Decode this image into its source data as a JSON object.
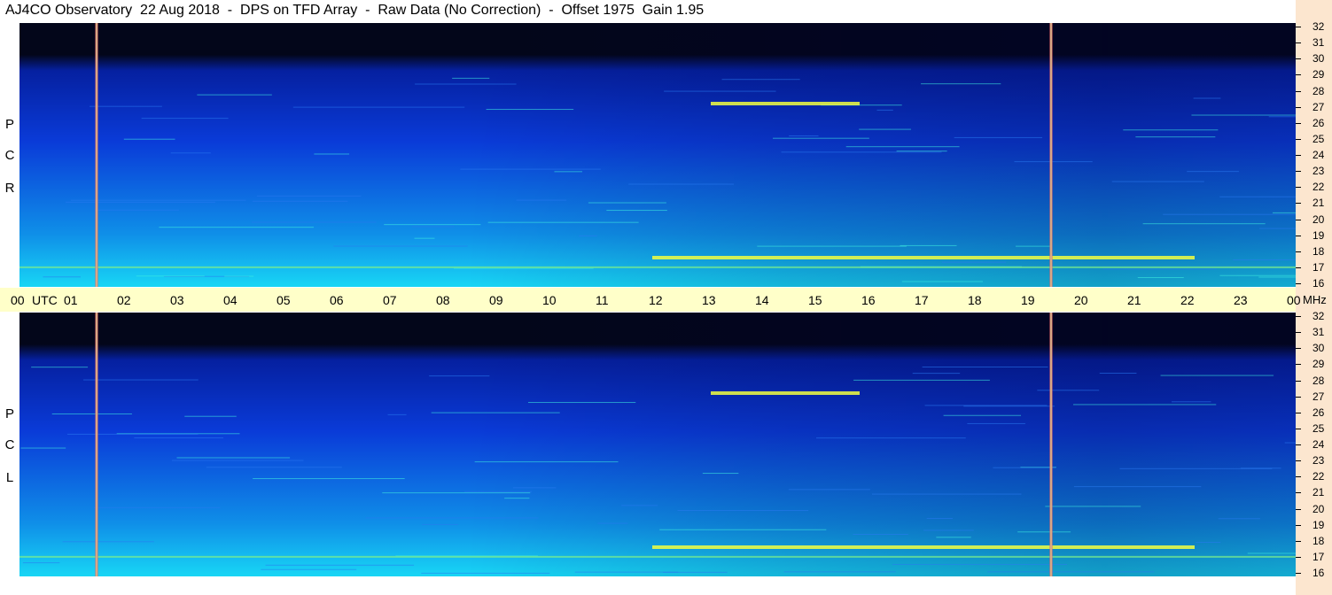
{
  "title": "AJ4CO Observatory  22 Aug 2018  -  DPS on TFD Array  -  Raw Data (No Correction)  -  Offset 1975  Gain 1.95",
  "panels": [
    {
      "id": "rcp",
      "label_letters": [
        "R",
        "C",
        "P"
      ]
    },
    {
      "id": "lcp",
      "label_letters": [
        "L",
        "C",
        "P"
      ]
    }
  ],
  "time_axis": {
    "start_label": "00",
    "unit_label": "UTC",
    "hour_labels": [
      "01",
      "02",
      "03",
      "04",
      "05",
      "06",
      "07",
      "08",
      "09",
      "10",
      "11",
      "12",
      "13",
      "14",
      "15",
      "16",
      "17",
      "18",
      "19",
      "20",
      "21",
      "22",
      "23"
    ],
    "end_label": "00",
    "end_unit": "MHz"
  },
  "chart_data": [
    {
      "type": "heatmap",
      "title": "AJ4CO Observatory  22 Aug 2018  -  DPS on TFD Array  -  Raw Data (No Correction)  -  Offset 1975  Gain 1.95",
      "polarization": "RCP",
      "x_range_utc_hours": [
        0,
        24
      ],
      "y_range_mhz": [
        16,
        32
      ],
      "y_ticks": [
        "32",
        "31",
        "30",
        "29",
        "28",
        "27",
        "26",
        "25",
        "24",
        "23",
        "22",
        "21",
        "20",
        "19",
        "18",
        "17",
        "16"
      ],
      "vertical_marker_times_utc": [
        1.45,
        19.4
      ],
      "notable_signals": [
        {
          "freq_mhz": 27.2,
          "utc_start": 13.0,
          "utc_end": 15.8,
          "intensity": "high"
        },
        {
          "freq_mhz": 17.6,
          "utc_start": 11.9,
          "utc_end": 22.1,
          "intensity": "high"
        },
        {
          "freq_mhz": 17.0,
          "utc_start": 0.0,
          "utc_end": 24.0,
          "intensity": "medium"
        }
      ]
    },
    {
      "type": "heatmap",
      "polarization": "LCP",
      "x_range_utc_hours": [
        0,
        24
      ],
      "y_range_mhz": [
        16,
        32
      ],
      "y_ticks": [
        "32",
        "31",
        "30",
        "29",
        "28",
        "27",
        "26",
        "25",
        "24",
        "23",
        "22",
        "21",
        "20",
        "19",
        "18",
        "17",
        "16"
      ],
      "vertical_marker_times_utc": [
        1.45,
        19.4
      ],
      "notable_signals": [
        {
          "freq_mhz": 27.2,
          "utc_start": 13.0,
          "utc_end": 15.8,
          "intensity": "high"
        },
        {
          "freq_mhz": 17.6,
          "utc_start": 11.9,
          "utc_end": 22.1,
          "intensity": "high"
        },
        {
          "freq_mhz": 17.0,
          "utc_start": 0.0,
          "utc_end": 24.0,
          "intensity": "medium"
        }
      ]
    }
  ],
  "colors": {
    "background": "#ffffff",
    "axis_band": "#ffffc9",
    "right_strip": "#fce6cf",
    "spectrogram_low": "#03061a",
    "spectrogram_mid": "#0a3bd8",
    "spectrogram_high": "#18d6f5",
    "signal_hot": "#f2ff40",
    "marker_line": "#e86a6a"
  }
}
